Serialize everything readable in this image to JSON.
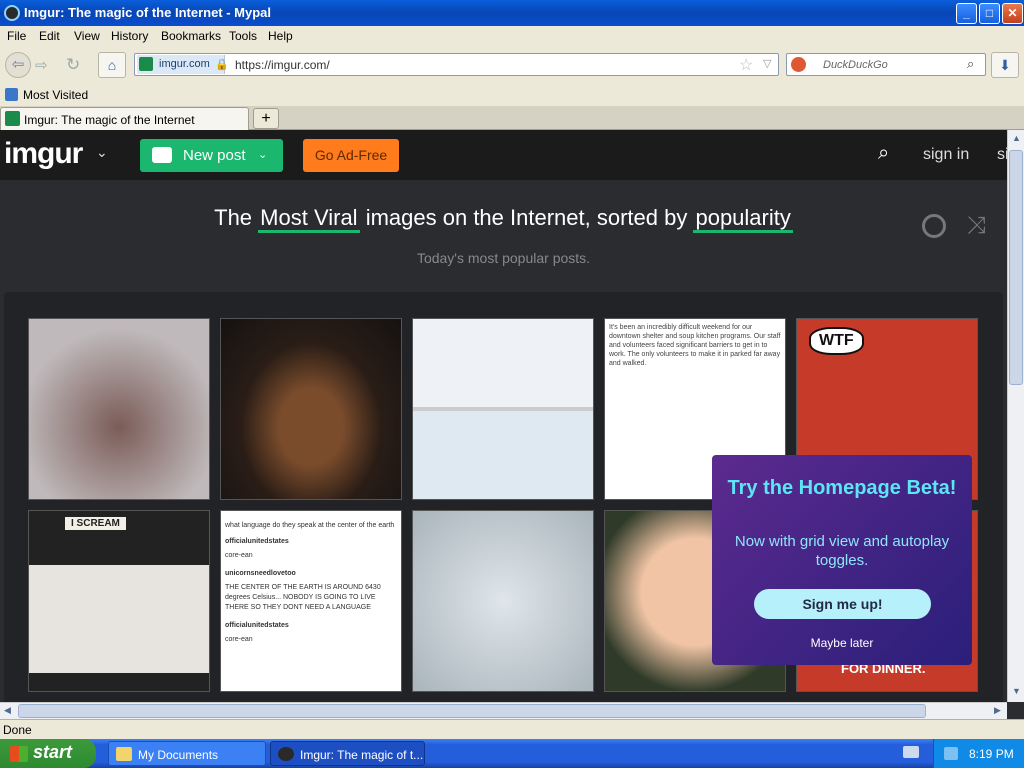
{
  "window": {
    "title": "Imgur: The magic of the Internet - Mypal",
    "minimize": "_",
    "maximize": "□",
    "close": "✕"
  },
  "menu": [
    "File",
    "Edit",
    "View",
    "History",
    "Bookmarks",
    "Tools",
    "Help"
  ],
  "nav": {
    "back": "⇦",
    "forward": "⇨",
    "reload": "↻",
    "home": "⌂",
    "download": "⬇"
  },
  "urlbar": {
    "site": "imgur.com",
    "lock": "🔒",
    "url": "https://imgur.com/",
    "star": "☆",
    "drop": "▽"
  },
  "searchbar": {
    "placeholder": "DuckDuckGo",
    "icon": "⌕"
  },
  "bookmarks": {
    "item": "Most Visited"
  },
  "tab": {
    "title": "Imgur: The magic of the Internet",
    "newtab": "+"
  },
  "header": {
    "logo": "imgur",
    "logo_chevron": "⌄",
    "new_post": "New post",
    "new_post_chevron": "⌄",
    "ad_free": "Go Ad-Free",
    "search_icon": "⌕",
    "sign_in": "sign in",
    "sign_up": "si"
  },
  "headline": {
    "prefix": "The",
    "sort": "Most Viral",
    "middle": "images on the Internet, sorted by",
    "order": "popularity",
    "subtitle": "Today's most popular posts."
  },
  "tiles": {
    "t4_caption": "It's been an incredibly difficult weekend for our downtown shelter and soup kitchen programs. Our staff and volunteers faced significant barriers to get in to work. The only volunteers to make it in parked far away and walked.",
    "t5_caption": "WTF",
    "t6_caption": "I SCREAM",
    "t7_lines": [
      "what language do they speak at the center of the earth",
      "officialunitedstates",
      "core-ean",
      "unicornsneedlovetoo",
      "THE CENTER OF THE EARTH IS AROUND 6430 degrees Celsius... NOBODY IS GOING TO LIVE THERE SO THEY DONT NEED A LANGUAGE",
      "officialunitedstates",
      "core-ean"
    ],
    "t10_caption": "FOR DINNER."
  },
  "popup": {
    "title": "Try the Homepage Beta!",
    "description": "Now with grid view and autoplay toggles.",
    "button": "Sign me up!",
    "later": "Maybe later"
  },
  "scroll": {
    "up": "▲",
    "down": "▼",
    "left": "◀",
    "right": "▶"
  },
  "status": {
    "text": "Done"
  },
  "taskbar": {
    "start": "start",
    "items": [
      "My Documents",
      "Imgur: The magic of t..."
    ],
    "time": "8:19 PM"
  },
  "colors": {
    "accent": "#1bb76e",
    "ad_free": "#ff7b1c",
    "popup_title": "#5ce6f4"
  }
}
